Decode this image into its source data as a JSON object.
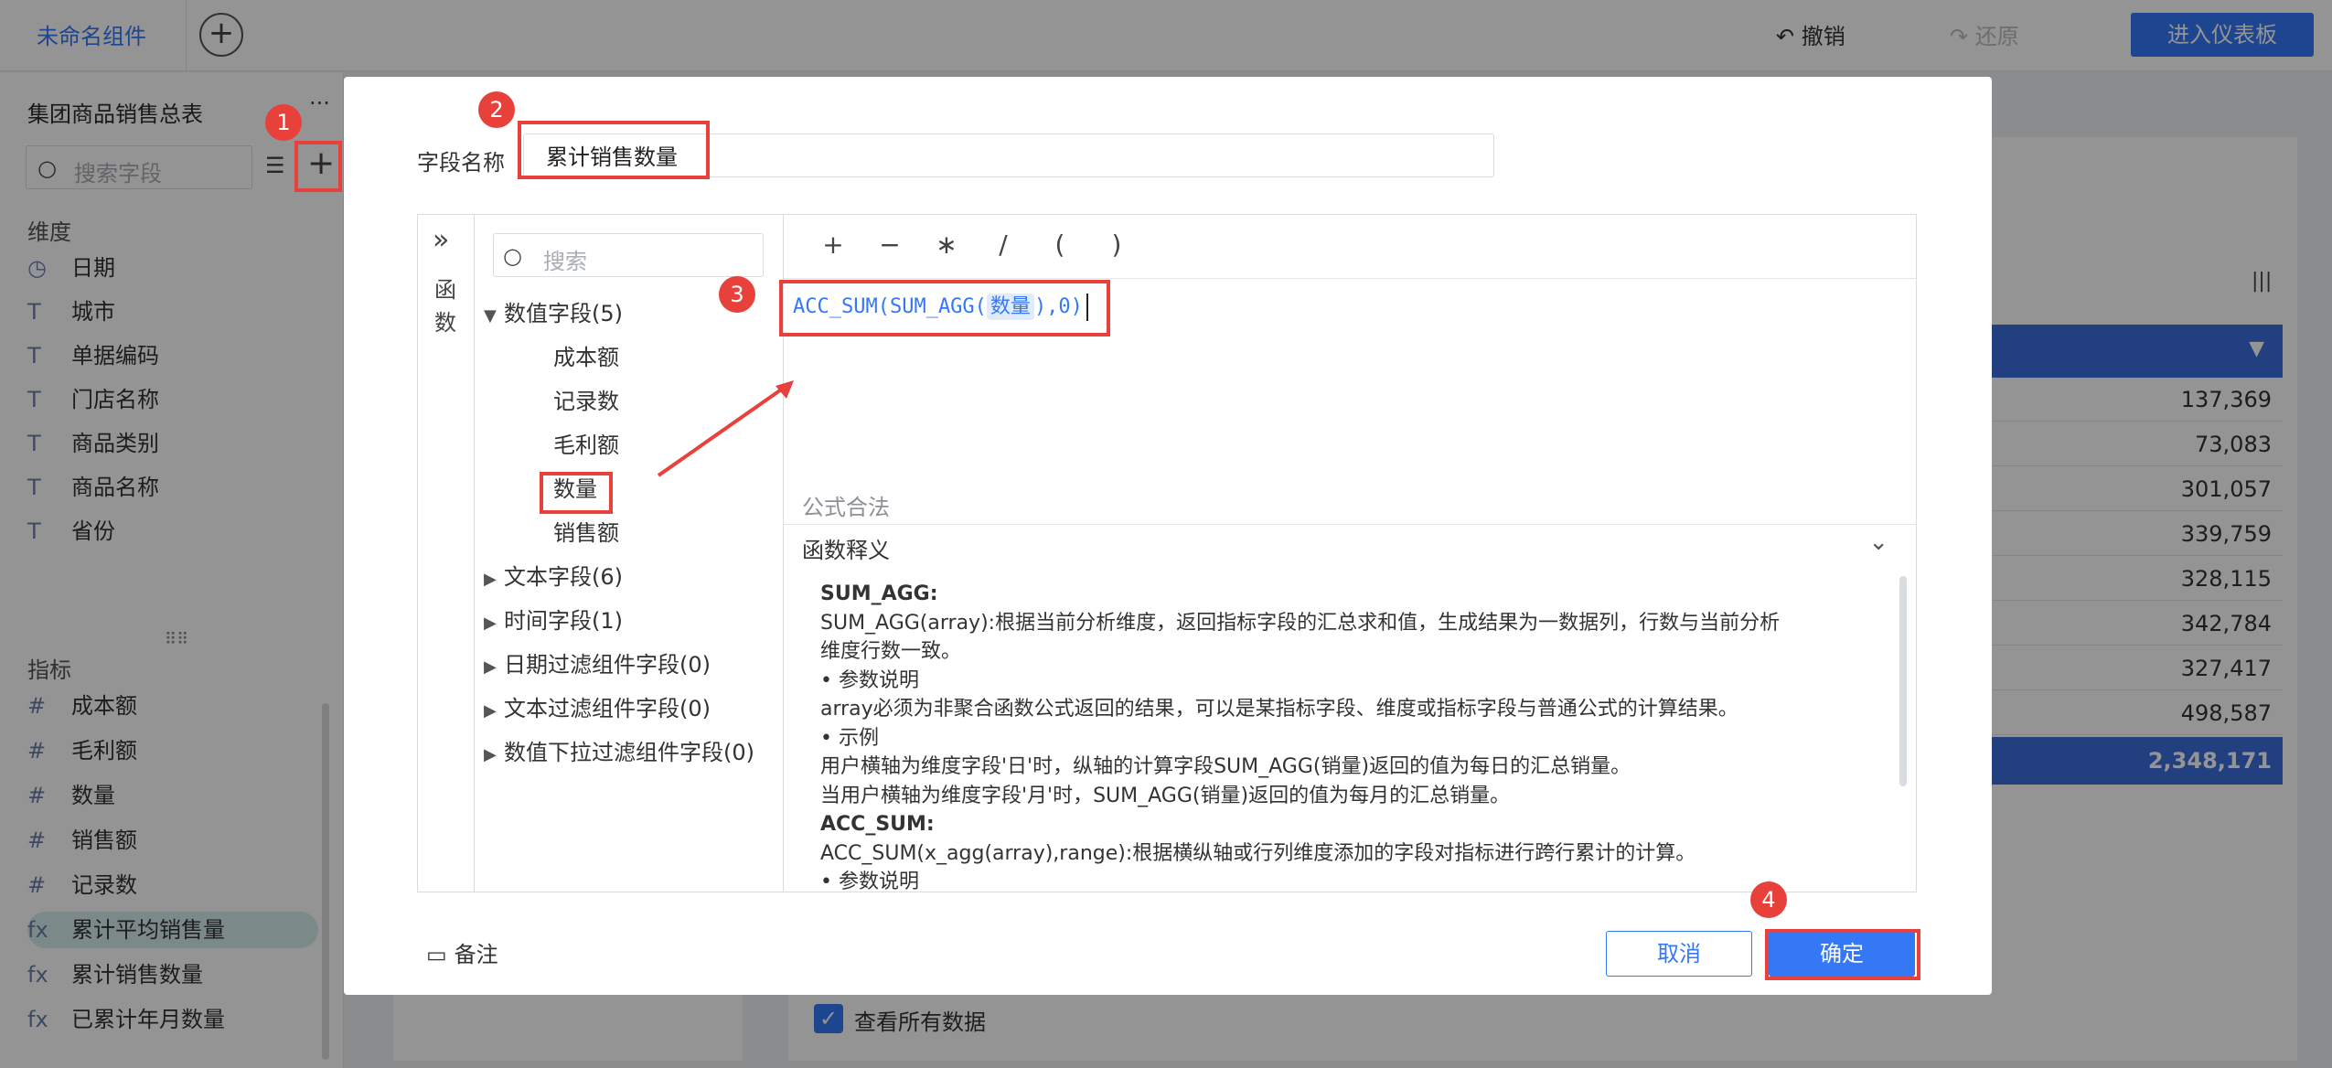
{
  "app": {
    "tab_title": "未命名组件",
    "undo_label": "撤销",
    "redo_label": "还原",
    "enter_dashboard_label": "进入仪表板"
  },
  "sidebar": {
    "dataset_name": "集团商品销售总表",
    "search_placeholder": "搜索字段",
    "dimensions_title": "维度",
    "dimensions": [
      {
        "icon": "clock-icon",
        "label": "日期"
      },
      {
        "icon": "text-type-icon",
        "label": "城市"
      },
      {
        "icon": "text-type-icon",
        "label": "单据编码"
      },
      {
        "icon": "text-type-icon",
        "label": "门店名称"
      },
      {
        "icon": "text-type-icon",
        "label": "商品类别"
      },
      {
        "icon": "text-type-icon",
        "label": "商品名称"
      },
      {
        "icon": "text-type-icon",
        "label": "省份"
      }
    ],
    "measures_title": "指标",
    "measures": [
      {
        "icon": "number-type-icon",
        "label": "成本额"
      },
      {
        "icon": "number-type-icon",
        "label": "毛利额"
      },
      {
        "icon": "number-type-icon",
        "label": "数量"
      },
      {
        "icon": "number-type-icon",
        "label": "销售额"
      },
      {
        "icon": "number-type-icon",
        "label": "记录数"
      },
      {
        "icon": "formula-icon",
        "label": "累计平均销售量"
      },
      {
        "icon": "formula-icon",
        "label": "累计销售数量"
      },
      {
        "icon": "formula-icon",
        "label": "已累计年月数量"
      }
    ]
  },
  "table": {
    "values": [
      "137,369",
      "73,083",
      "301,057",
      "339,759",
      "328,115",
      "342,784",
      "327,417",
      "498,587"
    ],
    "total": "2,348,171"
  },
  "view_all_label": "查看所有数据",
  "dialog": {
    "field_name_label": "字段名称",
    "field_name_value": "累计销售数量",
    "collapse_label_1": "函",
    "collapse_label_2": "数",
    "search_placeholder": "搜索",
    "tree": {
      "numeric_group": "数值字段(5)",
      "numeric_fields": [
        "成本额",
        "记录数",
        "毛利额",
        "数量",
        "销售额"
      ],
      "text_group": "文本字段(6)",
      "time_group": "时间字段(1)",
      "date_filter_group": "日期过滤组件字段(0)",
      "text_filter_group": "文本过滤组件字段(0)",
      "num_dropdown_group": "数值下拉过滤组件字段(0)"
    },
    "operators": [
      "+",
      "−",
      "∗",
      "/",
      "(",
      ")"
    ],
    "formula": {
      "prefix": "ACC_SUM(SUM_AGG(",
      "field_chip": "数量",
      "suffix": "),0)"
    },
    "validation": "公式合法",
    "doc_title": "函数释义",
    "doc_lines": [
      {
        "text": "SUM_AGG:",
        "bold": true
      },
      {
        "text": "SUM_AGG(array):根据当前分析维度，返回指标字段的汇总求和值，生成结果为一数据列，行数与当前分析",
        "bold": false
      },
      {
        "text": "维度行数一致。",
        "bold": false
      },
      {
        "text": "• 参数说明",
        "bold": false
      },
      {
        "text": "array必须为非聚合函数公式返回的结果，可以是某指标字段、维度或指标字段与普通公式的计算结果。",
        "bold": false
      },
      {
        "text": "• 示例",
        "bold": false
      },
      {
        "text": "用户横轴为维度字段'日'时，纵轴的计算字段SUM_AGG(销量)返回的值为每日的汇总销量。",
        "bold": false
      },
      {
        "text": "当用户横轴为维度字段'月'时，SUM_AGG(销量)返回的值为每月的汇总销量。",
        "bold": false
      },
      {
        "text": "ACC_SUM:",
        "bold": true
      },
      {
        "text": "ACC_SUM(x_agg(array),range):根据横纵轴或行列维度添加的字段对指标进行跨行累计的计算。",
        "bold": false
      },
      {
        "text": "• 参数说明",
        "bold": false
      }
    ],
    "note_label": "备注",
    "cancel_label": "取消",
    "ok_label": "确定"
  },
  "annotations": [
    "1",
    "2",
    "3",
    "4"
  ],
  "colors": {
    "accent": "#3478f6",
    "annotation_red": "#e8403a",
    "table_header": "#3c6ddd"
  }
}
